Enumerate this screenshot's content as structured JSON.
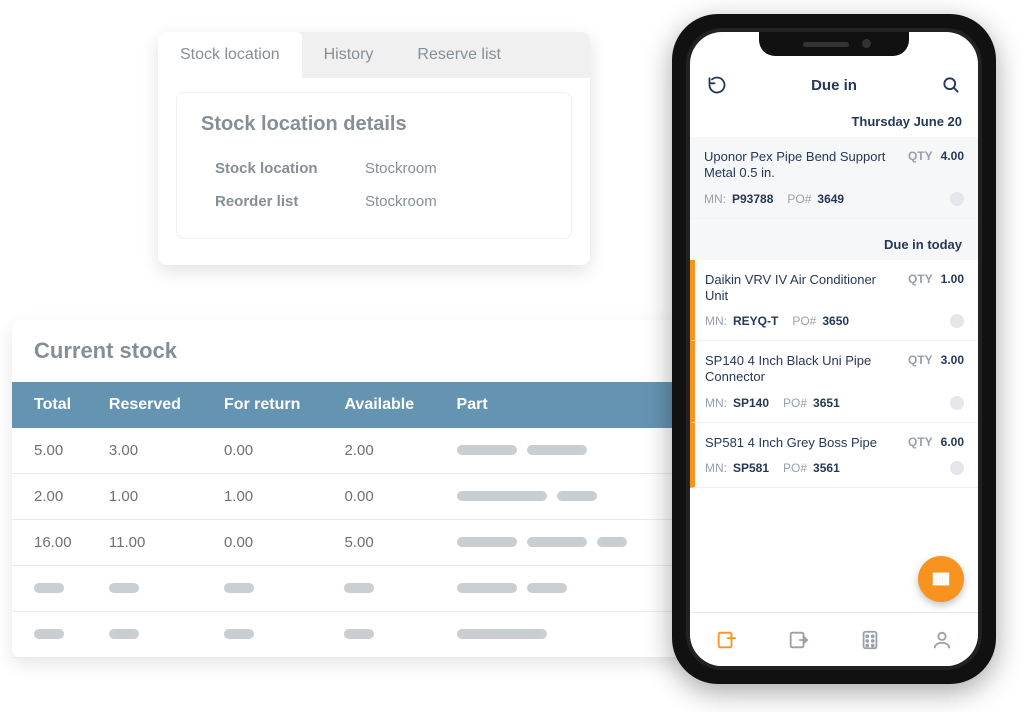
{
  "details": {
    "tabs": [
      "Stock location",
      "History",
      "Reserve list"
    ],
    "title": "Stock location details",
    "rows": [
      {
        "label": "Stock location",
        "value": "Stockroom"
      },
      {
        "label": "Reorder list",
        "value": "Stockroom"
      }
    ]
  },
  "stock": {
    "title": "Current stock",
    "headers": [
      "Total",
      "Reserved",
      "For return",
      "Available",
      "Part"
    ],
    "rows": [
      {
        "total": "5.00",
        "reserved": "3.00",
        "for_return": "0.00",
        "available": "2.00"
      },
      {
        "total": "2.00",
        "reserved": "1.00",
        "for_return": "1.00",
        "available": "0.00"
      },
      {
        "total": "16.00",
        "reserved": "11.00",
        "for_return": "0.00",
        "available": "5.00"
      }
    ]
  },
  "phone": {
    "header": "Due in",
    "sections": [
      {
        "title": "Thursday June 20",
        "highlight": false,
        "items": [
          {
            "name": "Uponor Pex Pipe Bend Support Metal 0.5 in.",
            "qty": "4.00",
            "mn": "P93788",
            "po": "3649"
          }
        ]
      },
      {
        "title": "Due in today",
        "highlight": true,
        "items": [
          {
            "name": "Daikin VRV IV Air Conditioner Unit",
            "qty": "1.00",
            "mn": "REYQ-T",
            "po": "3650"
          },
          {
            "name": "SP140 4 Inch Black Uni Pipe Connector",
            "qty": "3.00",
            "mn": "SP140",
            "po": "3651"
          },
          {
            "name": "SP581 4 Inch Grey Boss Pipe",
            "qty": "6.00",
            "mn": "SP581",
            "po": "3561"
          }
        ]
      }
    ],
    "labels": {
      "qty": "QTY",
      "mn": "MN:",
      "po": "PO#"
    }
  }
}
